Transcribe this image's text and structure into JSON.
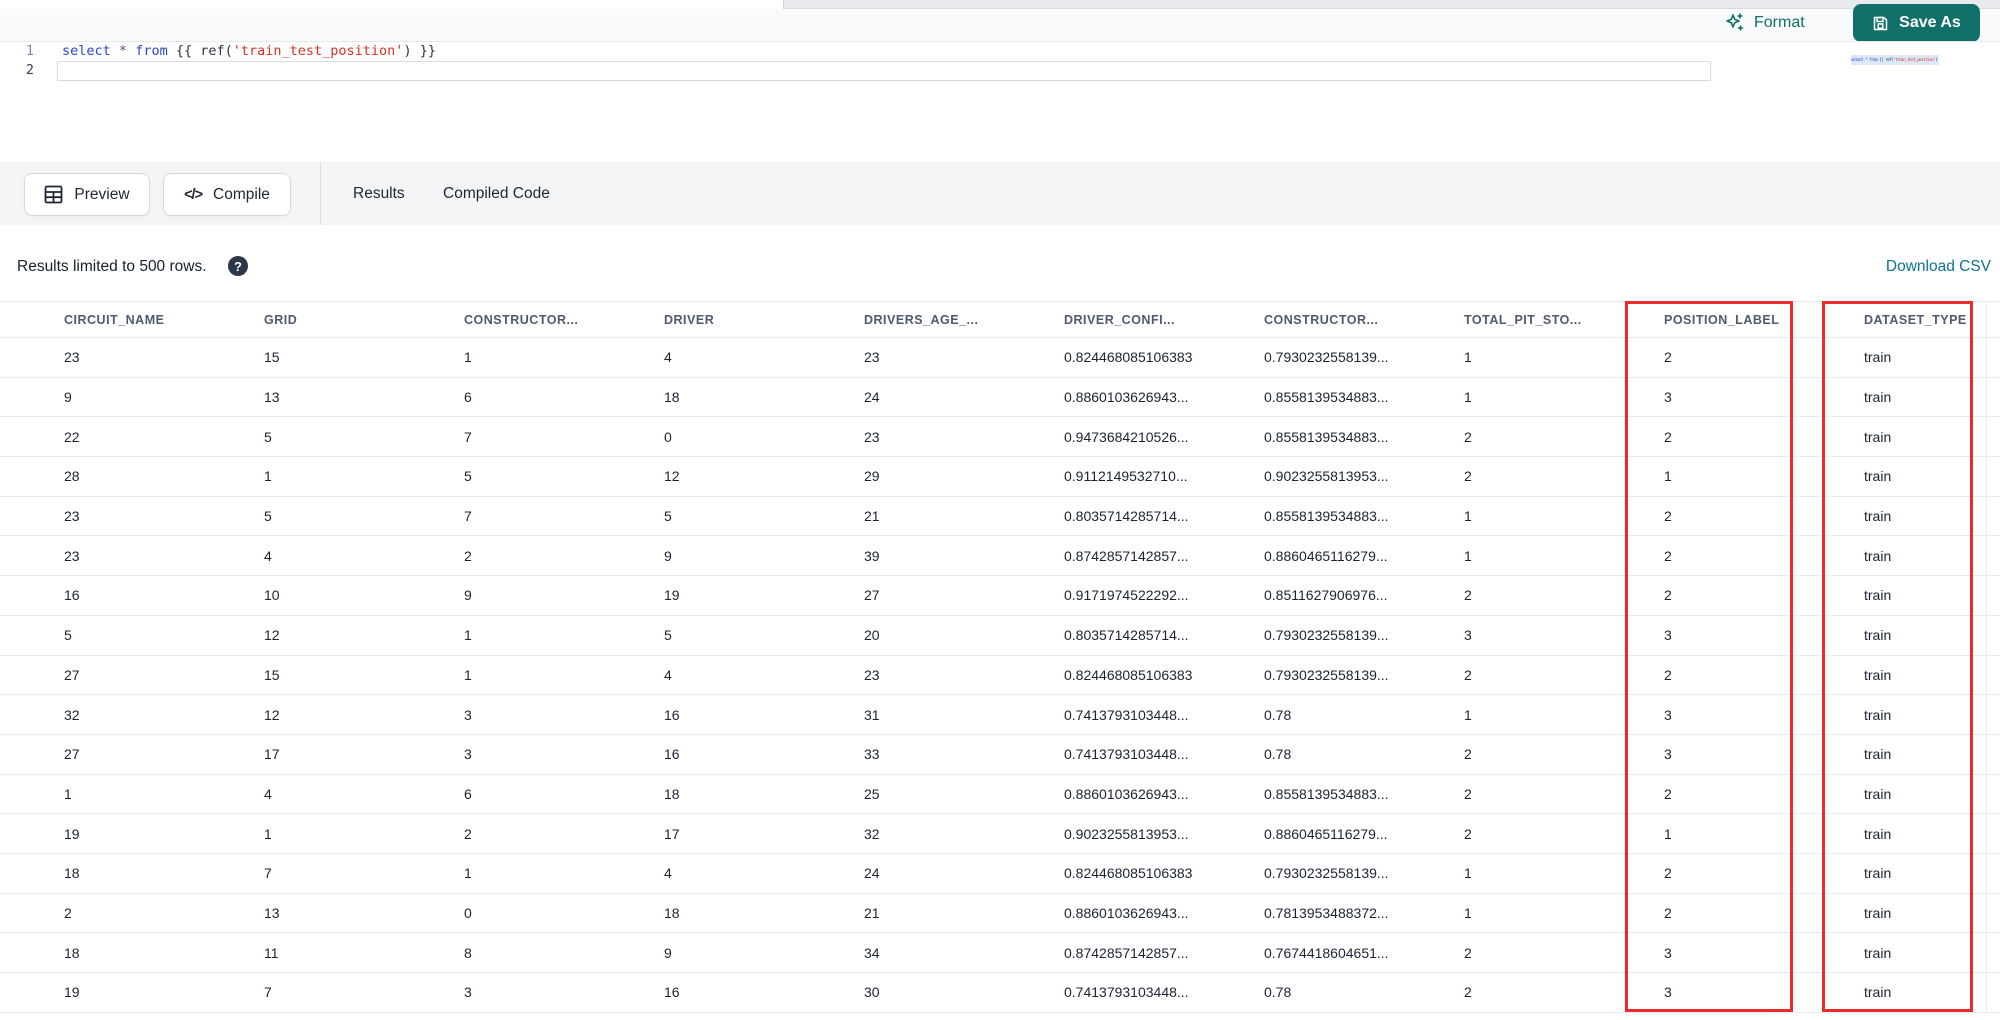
{
  "toolbar": {
    "format_label": "Format",
    "save_as_label": "Save As"
  },
  "editor": {
    "line_numbers": [
      "1",
      "2"
    ],
    "code_text": "select * from {{ ref('train_test_position') }}",
    "code_tokens": [
      {
        "text": "select",
        "type": "keyword"
      },
      {
        "text": " ",
        "type": "plain"
      },
      {
        "text": "*",
        "type": "operator"
      },
      {
        "text": " ",
        "type": "plain"
      },
      {
        "text": "from",
        "type": "keyword"
      },
      {
        "text": " {{ ref(",
        "type": "plain"
      },
      {
        "text": "'train_test_position'",
        "type": "string"
      },
      {
        "text": ") }}",
        "type": "plain"
      }
    ]
  },
  "actions": {
    "preview_label": "Preview",
    "compile_label": "Compile"
  },
  "tabs": [
    {
      "label": "Results",
      "active": true
    },
    {
      "label": "Compiled Code",
      "active": false
    }
  ],
  "results_bar": {
    "limit_text": "Results limited to 500 rows.",
    "help_glyph": "?",
    "download_label": "Download CSV"
  },
  "table": {
    "columns": [
      "CIRCUIT_NAME",
      "GRID",
      "CONSTRUCTOR...",
      "DRIVER",
      "DRIVERS_AGE_...",
      "DRIVER_CONFI...",
      "CONSTRUCTOR...",
      "TOTAL_PIT_STO...",
      "POSITION_LABEL",
      "DATASET_TYPE"
    ],
    "rows": [
      [
        "23",
        "15",
        "1",
        "4",
        "23",
        "0.824468085106383",
        "0.7930232558139...",
        "1",
        "2",
        "train"
      ],
      [
        "9",
        "13",
        "6",
        "18",
        "24",
        "0.8860103626943...",
        "0.8558139534883...",
        "1",
        "3",
        "train"
      ],
      [
        "22",
        "5",
        "7",
        "0",
        "23",
        "0.9473684210526...",
        "0.8558139534883...",
        "2",
        "2",
        "train"
      ],
      [
        "28",
        "1",
        "5",
        "12",
        "29",
        "0.9112149532710...",
        "0.9023255813953...",
        "2",
        "1",
        "train"
      ],
      [
        "23",
        "5",
        "7",
        "5",
        "21",
        "0.8035714285714...",
        "0.8558139534883...",
        "1",
        "2",
        "train"
      ],
      [
        "23",
        "4",
        "2",
        "9",
        "39",
        "0.8742857142857...",
        "0.8860465116279...",
        "1",
        "2",
        "train"
      ],
      [
        "16",
        "10",
        "9",
        "19",
        "27",
        "0.9171974522292...",
        "0.8511627906976...",
        "2",
        "2",
        "train"
      ],
      [
        "5",
        "12",
        "1",
        "5",
        "20",
        "0.8035714285714...",
        "0.7930232558139...",
        "3",
        "3",
        "train"
      ],
      [
        "27",
        "15",
        "1",
        "4",
        "23",
        "0.824468085106383",
        "0.7930232558139...",
        "2",
        "2",
        "train"
      ],
      [
        "32",
        "12",
        "3",
        "16",
        "31",
        "0.7413793103448...",
        "0.78",
        "1",
        "3",
        "train"
      ],
      [
        "27",
        "17",
        "3",
        "16",
        "33",
        "0.7413793103448...",
        "0.78",
        "2",
        "3",
        "train"
      ],
      [
        "1",
        "4",
        "6",
        "18",
        "25",
        "0.8860103626943...",
        "0.8558139534883...",
        "2",
        "2",
        "train"
      ],
      [
        "19",
        "1",
        "2",
        "17",
        "32",
        "0.9023255813953...",
        "0.8860465116279...",
        "2",
        "1",
        "train"
      ],
      [
        "18",
        "7",
        "1",
        "4",
        "24",
        "0.824468085106383",
        "0.7930232558139...",
        "1",
        "2",
        "train"
      ],
      [
        "2",
        "13",
        "0",
        "18",
        "21",
        "0.8860103626943...",
        "0.7813953488372...",
        "1",
        "2",
        "train"
      ],
      [
        "18",
        "11",
        "8",
        "9",
        "34",
        "0.8742857142857...",
        "0.7674418604651...",
        "2",
        "3",
        "train"
      ],
      [
        "19",
        "7",
        "3",
        "16",
        "30",
        "0.7413793103448...",
        "0.78",
        "2",
        "3",
        "train"
      ]
    ]
  },
  "highlights": {
    "color": "#ee2b2b",
    "highlighted_columns": [
      "POSITION_LABEL",
      "DATASET_TYPE"
    ]
  },
  "colors": {
    "accent_teal": "#11706a",
    "link_teal": "#0e7490",
    "keyword_blue": "#2a44c8",
    "string_red": "#d93025"
  }
}
